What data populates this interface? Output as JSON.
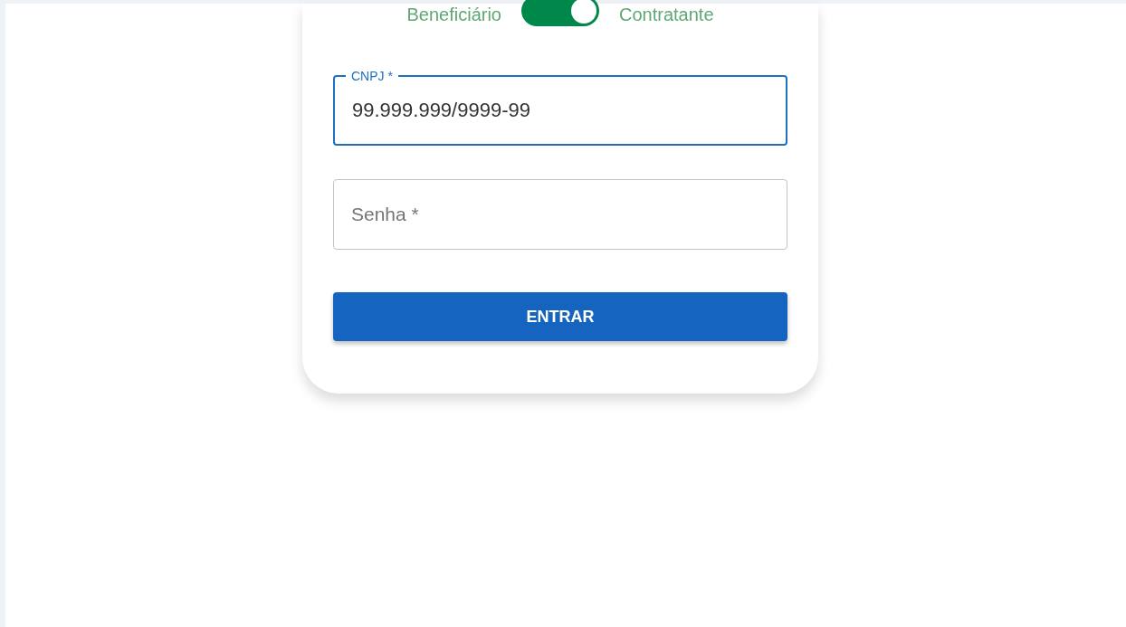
{
  "user_type_toggle": {
    "left_label": "Beneficiário",
    "right_label": "Contratante",
    "on": true
  },
  "fields": [
    {
      "label": "CNPJ *",
      "value": "99.999.999/9999-99",
      "focused": true
    },
    {
      "label": "Senha *",
      "focused": false
    }
  ],
  "submit_button": {
    "label": "ENTRAR"
  }
}
